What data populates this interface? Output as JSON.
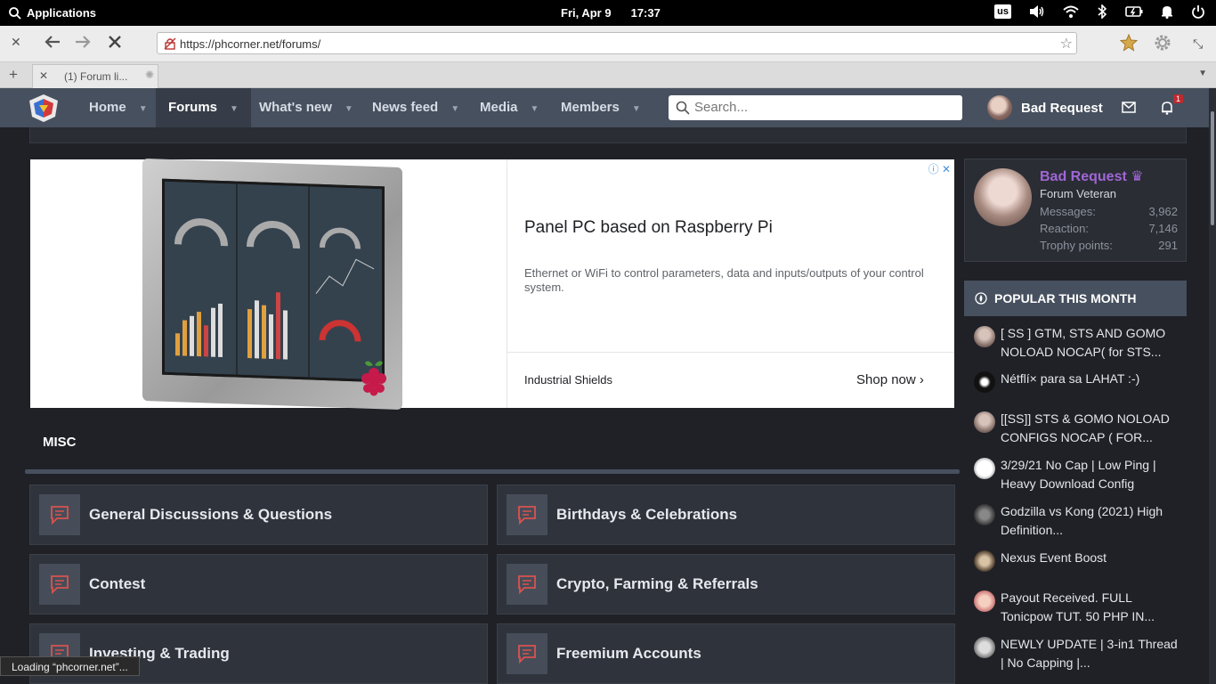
{
  "topbar": {
    "applications_label": "Applications",
    "date": "Fri, Apr 9",
    "time": "17:37",
    "keyboard_layout": "us"
  },
  "browser": {
    "url": "https://phcorner.net/forums/",
    "tab_title": "(1) Forum li..."
  },
  "site_nav": {
    "items": [
      "Home",
      "Forums",
      "What's new",
      "News feed",
      "Media",
      "Members"
    ],
    "active": "Forums",
    "search_placeholder": "Search...",
    "username": "Bad Request",
    "alerts_count": "1"
  },
  "ad": {
    "title": "Panel PC based on Raspberry Pi",
    "description": "Ethernet or WiFi to control parameters, data and inputs/outputs of your control system.",
    "advertiser": "Industrial Shields",
    "cta": "Shop now"
  },
  "misc": {
    "title": "MISC",
    "nodes": [
      "General Discussions & Questions",
      "Birthdays & Celebrations",
      "Contest",
      "Crypto, Farming & Referrals",
      "Investing & Trading",
      "Freemium Accounts"
    ]
  },
  "profile": {
    "name": "Bad Request",
    "role": "Forum Veteran",
    "stats": [
      {
        "label": "Messages:",
        "value": "3,962"
      },
      {
        "label": "Reaction:",
        "value": "7,146"
      },
      {
        "label": "Trophy points:",
        "value": "291"
      }
    ]
  },
  "popular": {
    "title": "POPULAR THIS MONTH",
    "items": [
      "[ SS ] GTM, STS AND GOMO NOLOAD NOCAP( for STS...",
      "Nétflí× para sa LAHAT :-)",
      "[[SS]] STS & GOMO NOLOAD CONFIGS NOCAP ( FOR...",
      "3/29/21 No Cap | Low Ping | Heavy Download Config",
      "Godzilla vs Kong (2021) High Definition...",
      "Nexus Event Boost",
      "Payout Received. FULL Tonicpow TUT. 50 PHP IN...",
      "NEWLY UPDATE | 3-in1 Thread | No Capping |..."
    ]
  },
  "status": {
    "loading_text": "Loading “phcorner.net”..."
  },
  "colors": {
    "nav_bg": "#47505e",
    "page_bg": "#1f2127",
    "username_purple": "#a066d6",
    "node_icon_red": "#d9534f"
  }
}
